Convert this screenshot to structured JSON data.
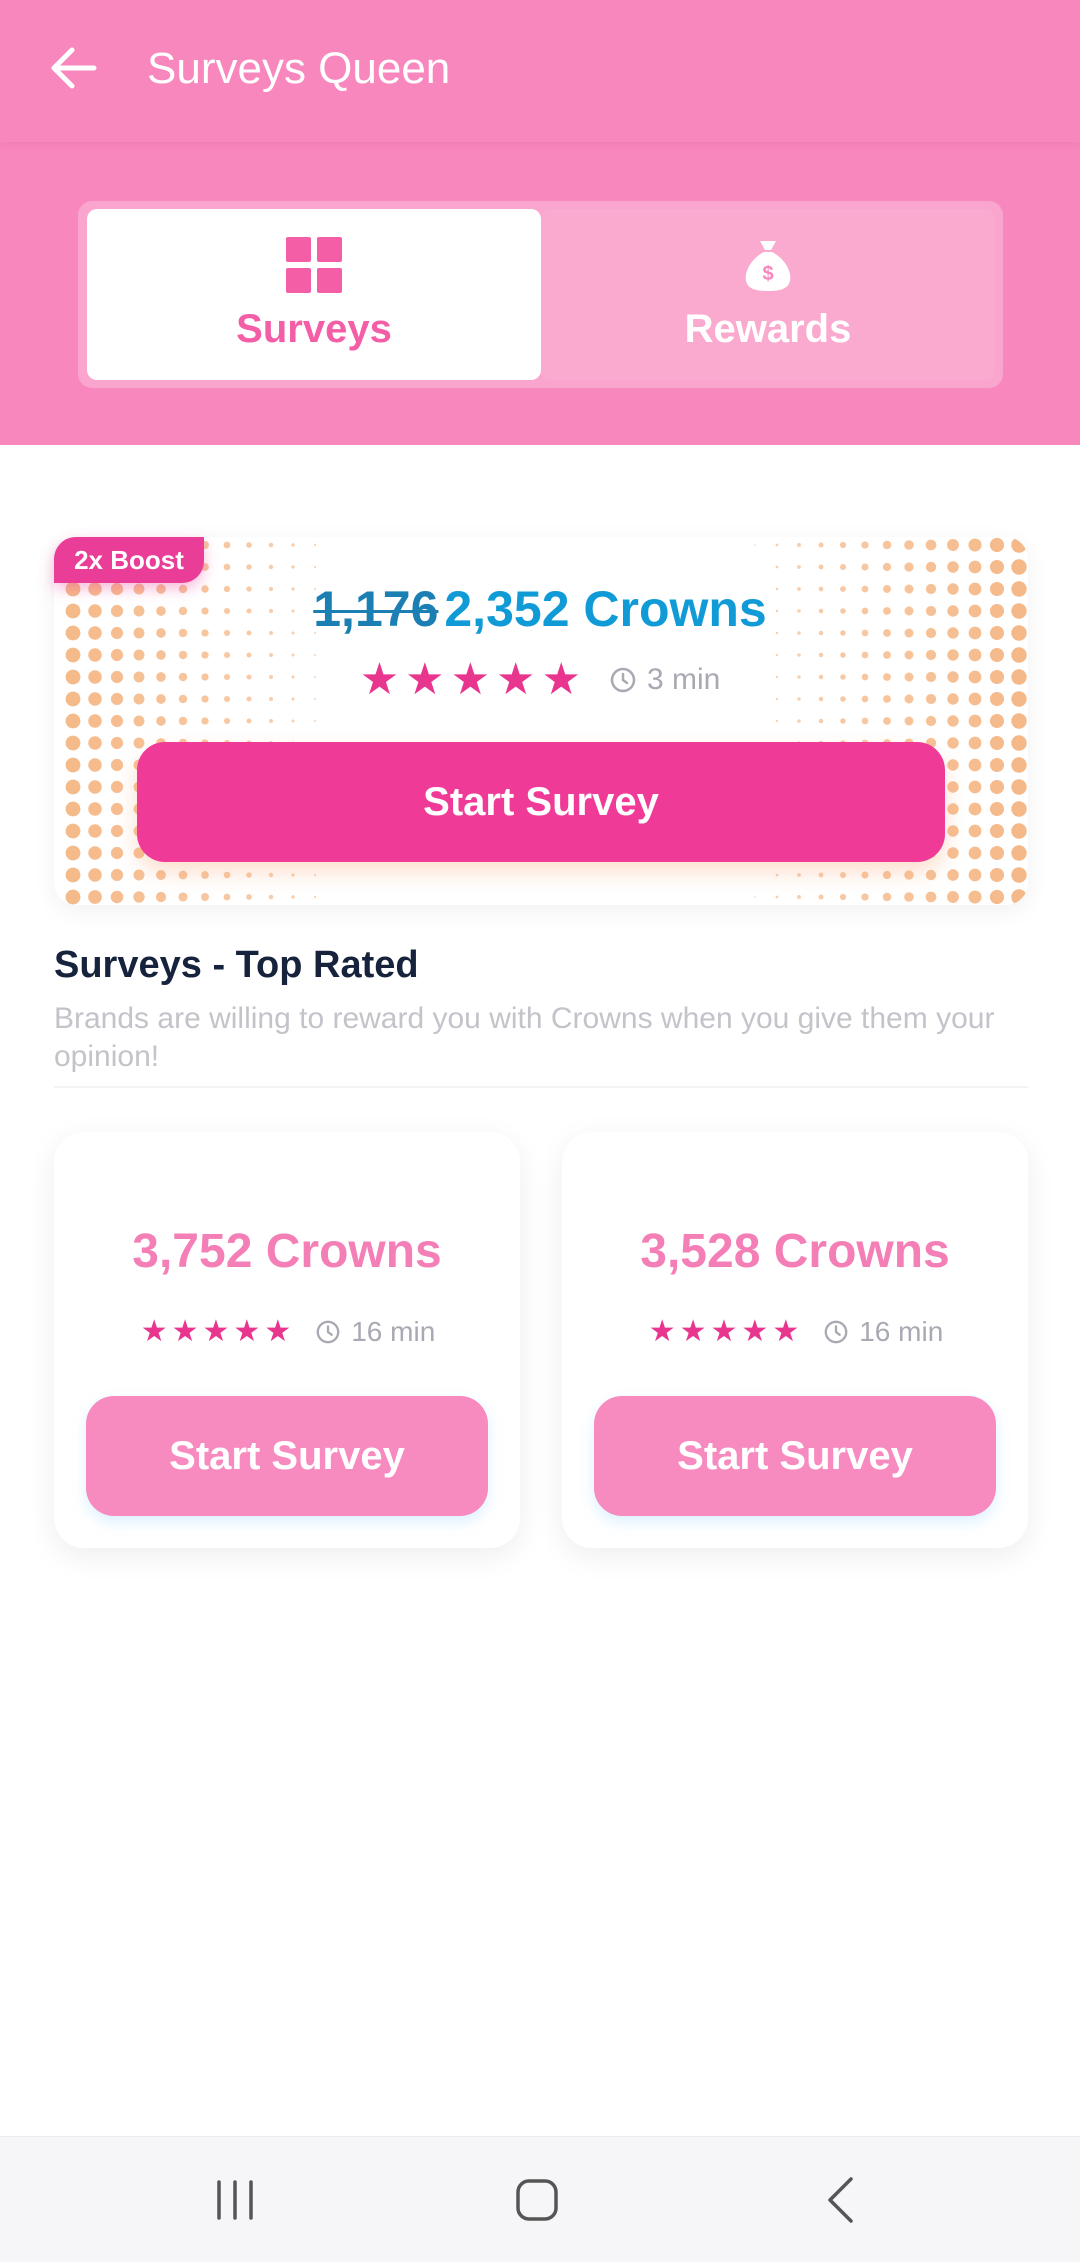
{
  "app": {
    "title": "Surveys Queen"
  },
  "tabs": [
    {
      "label": "Surveys",
      "icon": "grid-icon",
      "active": true
    },
    {
      "label": "Rewards",
      "icon": "money-bag-icon",
      "active": false
    }
  ],
  "featured": {
    "badge": "2x Boost",
    "old_crowns": "1,176",
    "new_crowns": "2,352 Crowns",
    "rating": 5,
    "time": "3 min",
    "button_label": "Start Survey"
  },
  "section": {
    "title": "Surveys - Top Rated",
    "subtitle": "Brands are willing to reward you with Crowns when you give them your opinion!"
  },
  "surveys": [
    {
      "crowns": "3,752 Crowns",
      "rating": 5,
      "time": "16 min",
      "button_label": "Start Survey"
    },
    {
      "crowns": "3,528 Crowns",
      "rating": 5,
      "time": "16 min",
      "button_label": "Start Survey"
    }
  ],
  "colors": {
    "header": "#f887bd",
    "accent": "#ef3a98",
    "crowns_blue": "#119bd6",
    "card_button": "#f78abf"
  },
  "system_nav": [
    "recents-icon",
    "home-icon",
    "back-icon"
  ]
}
